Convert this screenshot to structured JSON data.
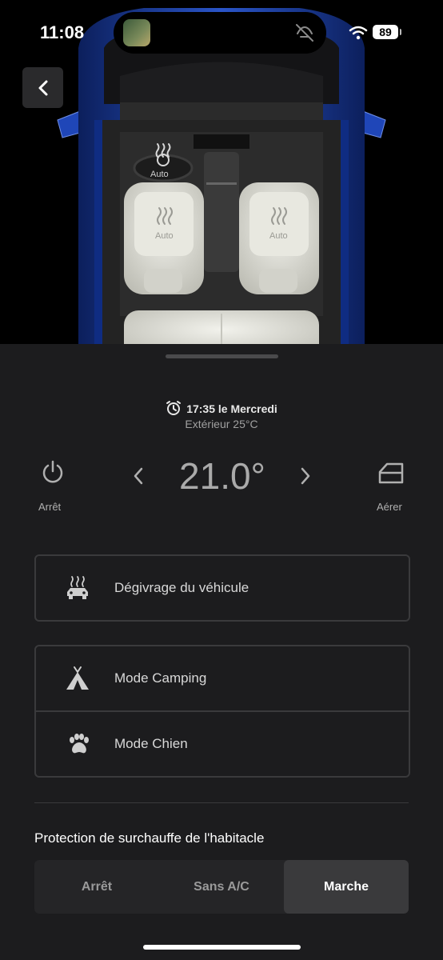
{
  "status_bar": {
    "time": "11:08",
    "battery": "89"
  },
  "seats": {
    "steering_label": "Auto",
    "left_seat_label": "Auto",
    "right_seat_label": "Auto"
  },
  "schedule": {
    "alarm_text": "17:35 le Mercredi",
    "exterior": "Extérieur 25°C"
  },
  "climate": {
    "power_label": "Arrêt",
    "temperature": "21.0°",
    "vent_label": "Aérer"
  },
  "defrost": {
    "label": "Dégivrage du véhicule"
  },
  "modes": {
    "camping_label": "Mode Camping",
    "dog_label": "Mode Chien"
  },
  "overheat": {
    "title": "Protection de surchauffe de l'habitacle",
    "options": [
      "Arrêt",
      "Sans A/C",
      "Marche"
    ],
    "selected": "Marche"
  },
  "colors": {
    "car_body": "#1e3f9a",
    "seat": "#e4e4dc",
    "background": "#1c1c1e"
  }
}
